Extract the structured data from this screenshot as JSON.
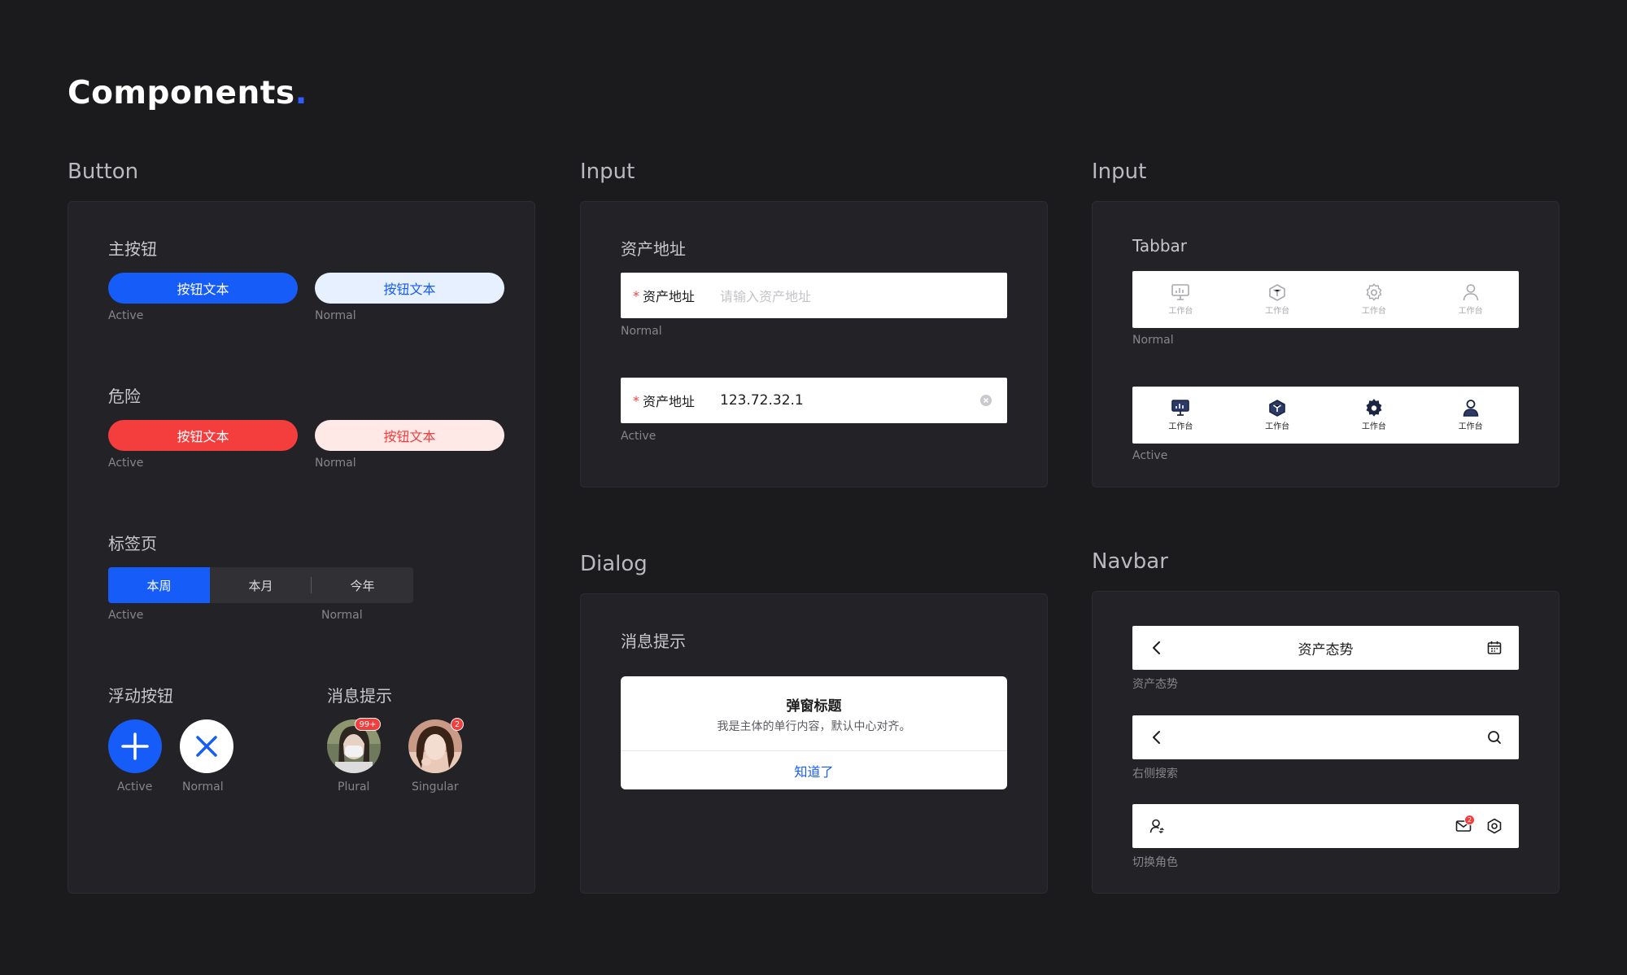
{
  "page": {
    "title": "Components",
    "title_dot": "."
  },
  "colors": {
    "primary": "#165cf8",
    "danger": "#f43d3d",
    "background": "#1b1b1e",
    "card": "#232327"
  },
  "button_section": {
    "title": "Button",
    "primary": {
      "label": "主按钮",
      "active_text": "按钮文本",
      "normal_text": "按钮文本",
      "active_state": "Active",
      "normal_state": "Normal"
    },
    "danger": {
      "label": "危险",
      "active_text": "按钮文本",
      "normal_text": "按钮文本",
      "active_state": "Active",
      "normal_state": "Normal"
    },
    "tabs": {
      "label": "标签页",
      "items": [
        "本周",
        "本月",
        "今年"
      ],
      "active_state": "Active",
      "normal_state": "Normal"
    },
    "fab": {
      "label": "浮动按钮",
      "active_state": "Active",
      "normal_state": "Normal"
    },
    "message": {
      "label": "消息提示",
      "plural_badge": "99+",
      "singular_badge": "2",
      "plural_state": "Plural",
      "singular_state": "Singular"
    }
  },
  "input_section": {
    "title": "Input",
    "label": "资产地址",
    "normal": {
      "required": "*",
      "field_label": "资产地址",
      "placeholder": "请输入资产地址",
      "state": "Normal"
    },
    "active": {
      "required": "*",
      "field_label": "资产地址",
      "value": "123.72.32.1",
      "state": "Active"
    }
  },
  "tabbar_section": {
    "title": "Input",
    "label": "Tabbar",
    "items": [
      {
        "icon": "monitor-icon",
        "label": "工作台"
      },
      {
        "icon": "cube-icon",
        "label": "工作台"
      },
      {
        "icon": "gear-icon",
        "label": "工作台"
      },
      {
        "icon": "user-icon",
        "label": "工作台"
      }
    ],
    "normal_state": "Normal",
    "active_state": "Active"
  },
  "dialog_section": {
    "title": "Dialog",
    "label": "消息提示",
    "dialog_title": "弹窗标题",
    "dialog_body": "我是主体的单行内容，默认中心对齐。",
    "confirm": "知道了"
  },
  "navbar_section": {
    "title": "Navbar",
    "bar1": {
      "title": "资产态势",
      "caption": "资产态势"
    },
    "bar2": {
      "caption": "右侧搜索"
    },
    "bar3": {
      "caption": "切换角色",
      "mail_badge": "2"
    }
  }
}
